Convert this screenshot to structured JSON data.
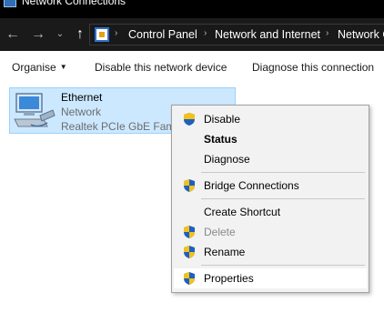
{
  "window": {
    "title": "Network Connections"
  },
  "nav": {
    "back_icon": "arrow-left-icon",
    "forward_icon": "arrow-right-icon",
    "recent_icon": "chevron-down-icon",
    "up_icon": "arrow-up-icon",
    "separator": "›",
    "breadcrumbs": [
      "Control Panel",
      "Network and Internet",
      "Network Connections"
    ]
  },
  "toolbar": {
    "organise_label": "Organise",
    "disable_label": "Disable this network device",
    "diagnose_label": "Diagnose this connection"
  },
  "connection": {
    "name": "Ethernet",
    "status": "Network",
    "device": "Realtek PCIe GbE Family Controller",
    "icon": "ethernet-adapter-icon"
  },
  "context_menu": {
    "items": [
      {
        "label": "Disable",
        "shield": true,
        "bold": false,
        "disabled": false
      },
      {
        "label": "Status",
        "shield": false,
        "bold": true,
        "disabled": false
      },
      {
        "label": "Diagnose",
        "shield": false,
        "bold": false,
        "disabled": false
      },
      {
        "label": "Bridge Connections",
        "shield": true,
        "bold": false,
        "disabled": false
      },
      {
        "label": "Create Shortcut",
        "shield": false,
        "bold": false,
        "disabled": false
      },
      {
        "label": "Delete",
        "shield": true,
        "bold": false,
        "disabled": true
      },
      {
        "label": "Rename",
        "shield": true,
        "bold": false,
        "disabled": false
      },
      {
        "label": "Properties",
        "shield": true,
        "bold": false,
        "disabled": false,
        "highlighted": true
      }
    ]
  },
  "colors": {
    "selection_bg": "#cce8ff",
    "selection_border": "#99d1ff",
    "menu_bg": "#f2f2f2",
    "shield_blue": "#1f5fbf",
    "shield_yellow": "#f2c21b"
  }
}
